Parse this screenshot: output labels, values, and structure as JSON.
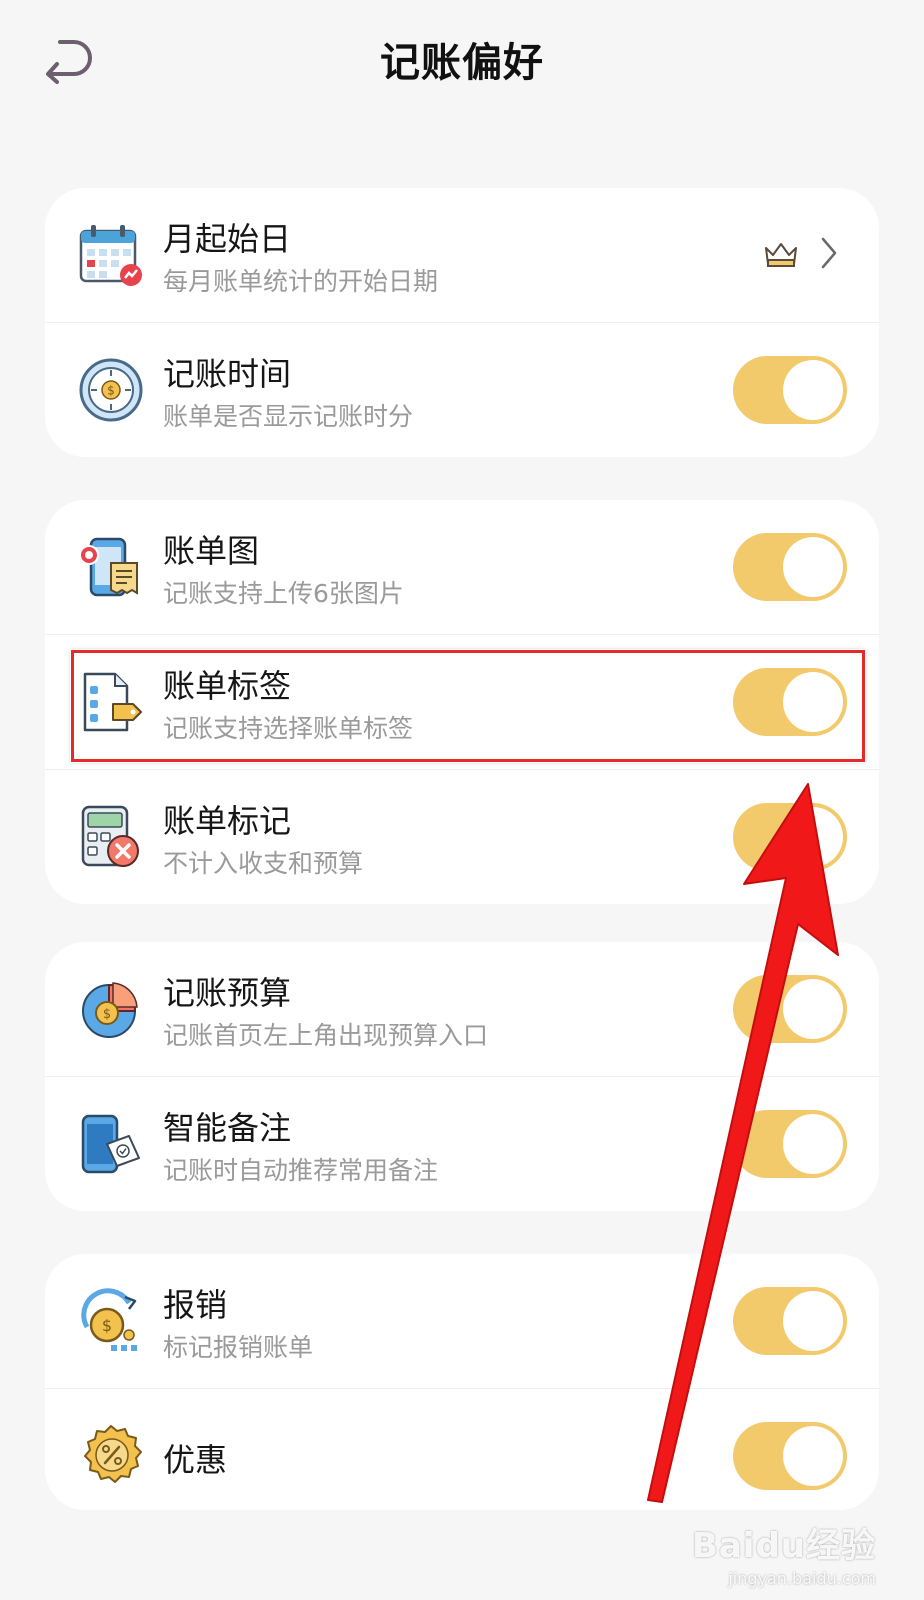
{
  "header": {
    "title": "记账偏好",
    "back_icon": "back-arrow-icon"
  },
  "colors": {
    "toggle_on": "#f2c96b",
    "highlight": "#e52a2a",
    "arrow": "#f01818"
  },
  "groups": [
    {
      "items": [
        {
          "title": "月起始日",
          "subtitle": "每月账单统计的开始日期",
          "icon": "calendar-icon",
          "control": "chevron",
          "badge_icon": "crown-icon"
        },
        {
          "title": "记账时间",
          "subtitle": "账单是否显示记账时分",
          "icon": "clock-icon",
          "control": "toggle",
          "on": true
        }
      ]
    },
    {
      "items": [
        {
          "title": "账单图",
          "subtitle": "记账支持上传6张图片",
          "icon": "bill-image-icon",
          "control": "toggle",
          "on": true
        },
        {
          "title": "账单标签",
          "subtitle": "记账支持选择账单标签",
          "icon": "tag-icon",
          "control": "toggle",
          "on": true
        },
        {
          "title": "账单标记",
          "subtitle": "不计入收支和预算",
          "icon": "calculator-icon",
          "control": "toggle",
          "on": true
        }
      ]
    },
    {
      "items": [
        {
          "title": "记账预算",
          "subtitle": "记账首页左上角出现预算入口",
          "icon": "budget-pie-icon",
          "control": "toggle",
          "on": true
        },
        {
          "title": "智能备注",
          "subtitle": "记账时自动推荐常用备注",
          "icon": "smart-note-icon",
          "control": "toggle",
          "on": true
        }
      ]
    },
    {
      "items": [
        {
          "title": "报销",
          "subtitle": "标记报销账单",
          "icon": "reimburse-icon",
          "control": "toggle",
          "on": true
        },
        {
          "title": "优惠",
          "icon": "discount-icon",
          "control": "toggle",
          "on": true
        }
      ]
    }
  ],
  "watermark": {
    "main": "Baidu经验",
    "url": "jingyan.baidu.com"
  }
}
